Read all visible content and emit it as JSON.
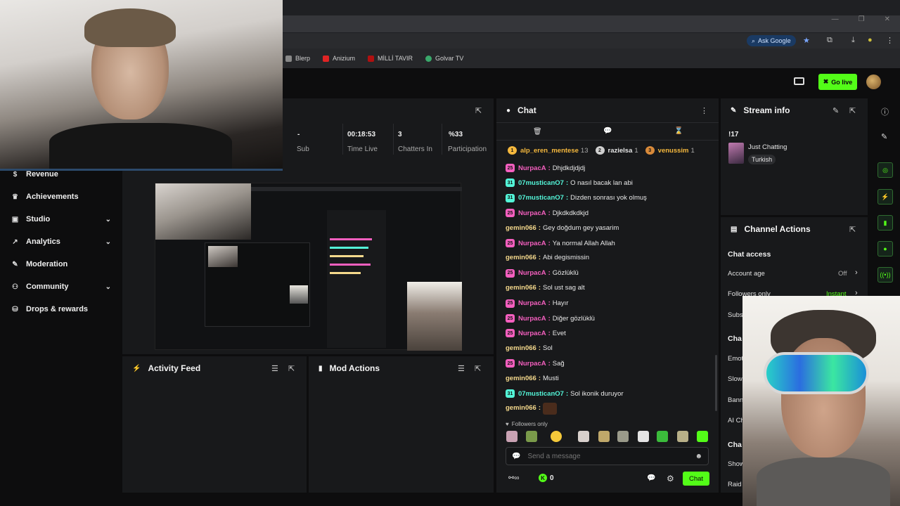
{
  "colors": {
    "accent": "#53fc18",
    "panel": "#18191b",
    "bg": "#0d0d0e"
  },
  "browser": {
    "ask_google": "Ask Google",
    "bookmarks": [
      {
        "label": "Blerp",
        "color": "#888888"
      },
      {
        "label": "Anizium",
        "color": "#e02424"
      },
      {
        "label": "MİLLİ TAVIR",
        "color": "#b01010"
      },
      {
        "label": "Golvar TV",
        "color": "#3aa86b"
      }
    ],
    "window_controls": [
      "—",
      "❐",
      "✕"
    ]
  },
  "header": {
    "go_live": "Go live"
  },
  "sidebar": {
    "items": [
      {
        "label": "Revenue",
        "icon": "dollar-icon"
      },
      {
        "label": "Achievements",
        "icon": "trophy-icon"
      },
      {
        "label": "Studio",
        "icon": "studio-icon",
        "expandable": true
      },
      {
        "label": "Analytics",
        "icon": "analytics-icon",
        "expandable": true
      },
      {
        "label": "Moderation",
        "icon": "wrench-icon"
      },
      {
        "label": "Community",
        "icon": "community-icon",
        "expandable": true
      },
      {
        "label": "Drops & rewards",
        "icon": "drops-icon"
      }
    ]
  },
  "stats": [
    {
      "value": "-",
      "label": "Sub"
    },
    {
      "value": "00:18:53",
      "label": "Time Live"
    },
    {
      "value": "3",
      "label": "Chatters In"
    },
    {
      "value": "%33",
      "label": "Participation"
    }
  ],
  "activity_feed": {
    "title": "Activity Feed"
  },
  "mod_actions": {
    "title": "Mod Actions"
  },
  "chat": {
    "title": "Chat",
    "leaders": [
      {
        "rank": "1",
        "name": "alp_eren_mentese",
        "count": "13",
        "color": "#f5b83d"
      },
      {
        "rank": "2",
        "name": "razielsa",
        "count": "1",
        "color": "#e6e6e6"
      },
      {
        "rank": "3",
        "name": "venussim",
        "count": "1",
        "color": "#f5b83d"
      }
    ],
    "messages": [
      {
        "user": "NurpacA",
        "text": "Dhjdkdjdjdj",
        "color": "#f55fbf",
        "badge": "25",
        "badge_color": "#f55fbf"
      },
      {
        "user": "07musticanO7",
        "text": "O nasıl bacak lan abi",
        "color": "#53f5d8",
        "badge": "31",
        "badge_color": "#53f5d8"
      },
      {
        "user": "07musticanO7",
        "text": "Dizden sonrası yok olmuş",
        "color": "#53f5d8",
        "badge": "31",
        "badge_color": "#53f5d8"
      },
      {
        "user": "NurpacA",
        "text": "Djkdkdkdkjd",
        "color": "#f55fbf",
        "badge": "25",
        "badge_color": "#f55fbf"
      },
      {
        "user": "gemin066",
        "text": "Gey doğdum gey yasarim",
        "color": "#f5d98c",
        "badge": "",
        "badge_color": ""
      },
      {
        "user": "NurpacA",
        "text": "Ya normal Allah Allah",
        "color": "#f55fbf",
        "badge": "25",
        "badge_color": "#f55fbf"
      },
      {
        "user": "gemin066",
        "text": "Abi degismissin",
        "color": "#f5d98c",
        "badge": "",
        "badge_color": ""
      },
      {
        "user": "NurpacA",
        "text": "Gözlüklü",
        "color": "#f55fbf",
        "badge": "25",
        "badge_color": "#f55fbf"
      },
      {
        "user": "gemin066",
        "text": "Sol ust sag alt",
        "color": "#f5d98c",
        "badge": "",
        "badge_color": ""
      },
      {
        "user": "NurpacA",
        "text": "Hayır",
        "color": "#f55fbf",
        "badge": "25",
        "badge_color": "#f55fbf"
      },
      {
        "user": "NurpacA",
        "text": "Diğer gözlüklü",
        "color": "#f55fbf",
        "badge": "25",
        "badge_color": "#f55fbf"
      },
      {
        "user": "NurpacA",
        "text": "Evet",
        "color": "#f55fbf",
        "badge": "25",
        "badge_color": "#f55fbf"
      },
      {
        "user": "gemin066",
        "text": "Sol",
        "color": "#f5d98c",
        "badge": "",
        "badge_color": ""
      },
      {
        "user": "NurpacA",
        "text": "Sağ",
        "color": "#f55fbf",
        "badge": "25",
        "badge_color": "#f55fbf"
      },
      {
        "user": "gemin066",
        "text": "Musti",
        "color": "#f5d98c",
        "badge": "",
        "badge_color": ""
      },
      {
        "user": "07musticanO7",
        "text": "Sol ikonik duruyor",
        "color": "#53f5d8",
        "badge": "31",
        "badge_color": "#53f5d8"
      },
      {
        "user": "gemin066",
        "text": "",
        "color": "#f5d98c",
        "badge": "",
        "badge_color": ""
      }
    ],
    "followers_only": "Followers only",
    "placeholder": "Send a message",
    "points": "0",
    "send_label": "Chat"
  },
  "stream_info": {
    "title": "Stream info",
    "stream_title": "!17",
    "category": "Just Chatting",
    "tag": "Turkish"
  },
  "channel_actions": {
    "title": "Channel Actions",
    "chat_access": "Chat access",
    "rows": [
      {
        "label": "Account age",
        "value": "Off"
      },
      {
        "label": "Followers only",
        "value": "Instant"
      },
      {
        "label": "Subs",
        "value": ""
      }
    ],
    "section_cut": "Cha",
    "rows2": [
      "Emot",
      "Slow",
      "Bann",
      "AI Ch"
    ],
    "section_cut2": "Cha",
    "rows3": [
      "Show",
      "Raid"
    ]
  }
}
